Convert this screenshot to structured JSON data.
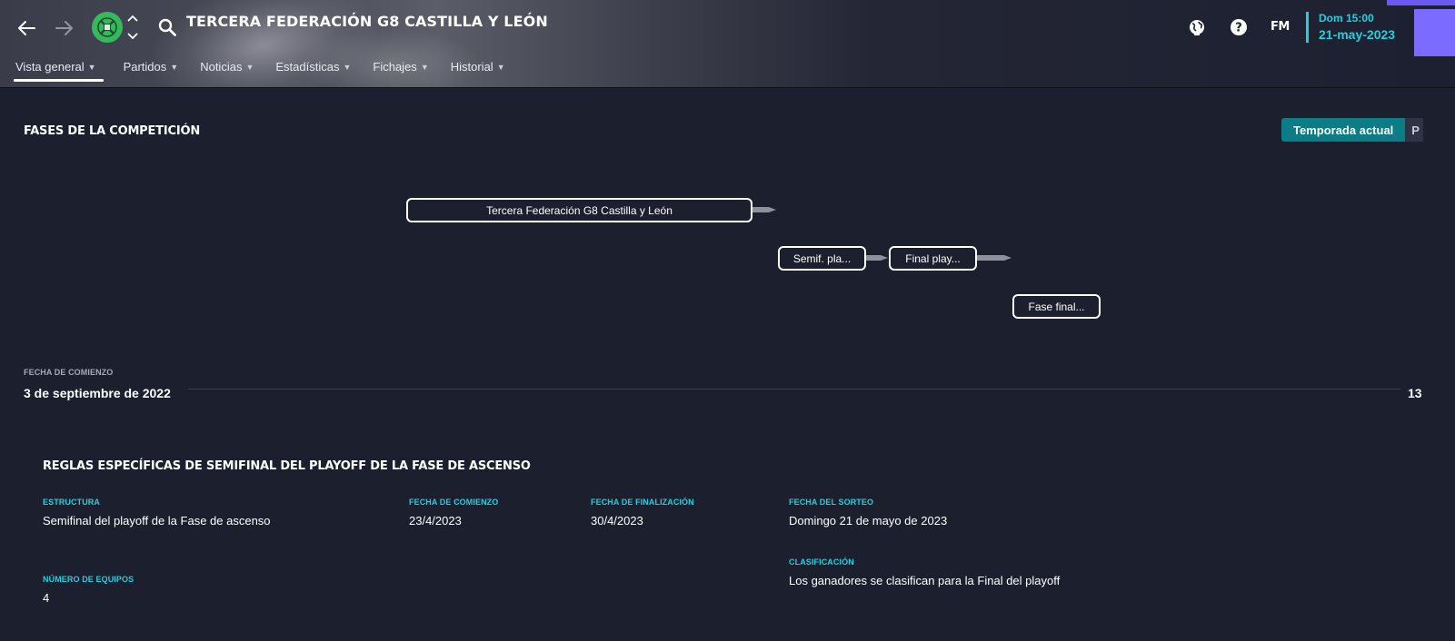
{
  "header": {
    "title": "TERCERA FEDERACIÓN G8 CASTILLA Y LEÓN",
    "tabs": [
      {
        "label": "Vista general"
      },
      {
        "label": "Partidos"
      },
      {
        "label": "Noticias"
      },
      {
        "label": "Estadísticas"
      },
      {
        "label": "Fichajes"
      },
      {
        "label": "Historial"
      }
    ],
    "fm_logo": "FM",
    "date_day": "Dom 15:00",
    "date_full": "21-may-2023",
    "accent_color": "#1fd0e0"
  },
  "phases": {
    "title": "FASES DE LA COMPETICIÓN",
    "season_toggle": {
      "active_label": "Temporada actual",
      "other_label": "P"
    },
    "stages": [
      {
        "label": "Tercera Federación G8 Castilla y León"
      },
      {
        "label": "Semif. pla..."
      },
      {
        "label": "Final play..."
      },
      {
        "label": "Fase final..."
      }
    ],
    "start_label": "FECHA DE COMIENZO",
    "start_date": "3 de septiembre de 2022",
    "end_date_partial": "13"
  },
  "rules": {
    "title": "REGLAS ESPECÍFICAS DE SEMIFINAL DEL PLAYOFF DE LA FASE DE ASCENSO",
    "fields": [
      {
        "label": "ESTRUCTURA",
        "value": "Semifinal del playoff de la Fase de ascenso"
      },
      {
        "label": "FECHA DE COMIENZO",
        "value": "23/4/2023"
      },
      {
        "label": "FECHA DE FINALIZACIÓN",
        "value": "30/4/2023"
      },
      {
        "label": "FECHA DEL SORTEO",
        "value": "Domingo 21 de mayo de 2023"
      },
      {
        "label": "CLASIFICACIÓN",
        "value": "Los ganadores se clasifican para la Final del playoff"
      },
      {
        "label": "NÚMERO DE EQUIPOS",
        "value": "4"
      }
    ]
  }
}
